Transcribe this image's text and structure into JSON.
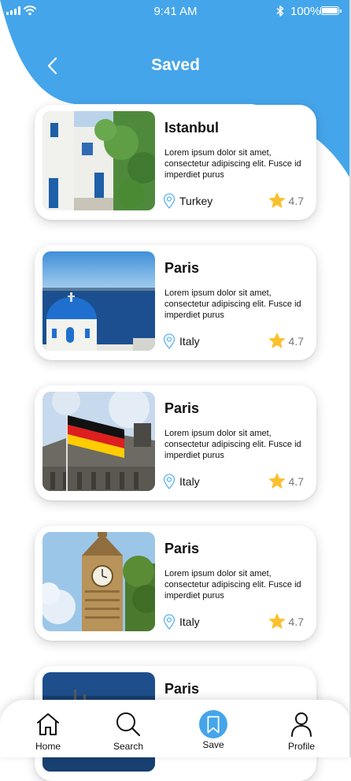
{
  "status_bar": {
    "time": "9:41 AM",
    "battery": "100%"
  },
  "header": {
    "title": "Saved",
    "back_icon": "chevron-left-icon"
  },
  "colors": {
    "accent": "#45A5EA",
    "star": "#FBC02D",
    "pin": "#5BB3EE"
  },
  "saved": [
    {
      "city": "Istanbul",
      "description": "Lorem ipsum dolor sit amet, consectetur adipiscing elit. Fusce id imperdiet purus",
      "country": "Turkey",
      "rating": "4.7"
    },
    {
      "city": "Paris",
      "description": "Lorem ipsum dolor sit amet, consectetur adipiscing elit. Fusce id imperdiet purus",
      "country": "Italy",
      "rating": "4.7"
    },
    {
      "city": "Paris",
      "description": "Lorem ipsum dolor sit amet, consectetur adipiscing elit. Fusce id imperdiet purus",
      "country": "Italy",
      "rating": "4.7"
    },
    {
      "city": "Paris",
      "description": "Lorem ipsum dolor sit amet, consectetur adipiscing elit. Fusce id imperdiet purus",
      "country": "Italy",
      "rating": "4.7"
    },
    {
      "city": "Paris"
    }
  ],
  "tabbar": {
    "items": [
      {
        "label": "Home",
        "icon": "home-icon"
      },
      {
        "label": "Search",
        "icon": "search-icon"
      },
      {
        "label": "Save",
        "icon": "bookmark-icon",
        "active": true
      },
      {
        "label": "Profile",
        "icon": "user-icon"
      }
    ]
  }
}
